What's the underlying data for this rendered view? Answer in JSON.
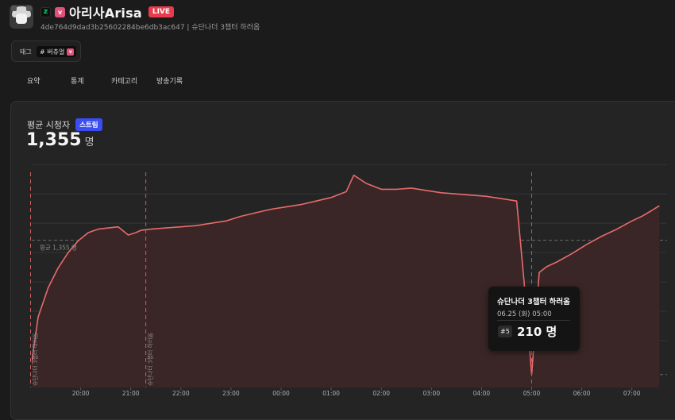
{
  "channel": {
    "name": "아리사Arisa",
    "live_badge": "LIVE",
    "platform_icon_label": "z",
    "vtuber_icon_label": "v",
    "subline": "4de764d9dad3b25602284be6db3ac647 | 슈단나더 3챕터 하러옴"
  },
  "tags": {
    "label": "태그",
    "items": [
      {
        "text": "# 버츄얼"
      }
    ]
  },
  "tabs": [
    "요약",
    "통계",
    "카테고리",
    "방송기록"
  ],
  "metric": {
    "label": "평균 시청자",
    "badge": "스트림",
    "value": "1,355",
    "unit": "명"
  },
  "chart_data": {
    "type": "area",
    "avg_label": "평균 1,355 명",
    "average": 1355,
    "ylim": [
      100,
      2050
    ],
    "x_ticks": [
      "20:00",
      "21:00",
      "22:00",
      "23:00",
      "00:00",
      "01:00",
      "02:00",
      "03:00",
      "04:00",
      "05:00",
      "06:00",
      "07:00"
    ],
    "x_tick_hours": [
      20,
      21,
      22,
      23,
      24,
      25,
      26,
      27,
      28,
      29,
      30,
      31
    ],
    "markers": [
      {
        "hour": 19.0,
        "label": "슈단나더 3챕터 하러옴"
      },
      {
        "hour": 21.3,
        "label": "슈단나더 3챕터 하러옴"
      },
      {
        "hour": 29.0,
        "label": ""
      }
    ],
    "series": [
      {
        "color": "#e86b6b",
        "x": [
          19.0,
          19.15,
          19.35,
          19.55,
          19.75,
          19.95,
          20.15,
          20.35,
          20.55,
          20.75,
          20.95,
          21.1,
          21.2,
          21.4,
          21.7,
          22.0,
          22.3,
          22.6,
          22.9,
          23.2,
          23.5,
          23.8,
          24.1,
          24.4,
          24.7,
          25.0,
          25.3,
          25.45,
          25.7,
          26.0,
          26.3,
          26.6,
          26.9,
          27.2,
          27.5,
          27.8,
          28.1,
          28.4,
          28.7,
          28.85,
          29.0,
          29.15,
          29.3,
          29.5,
          29.8,
          30.1,
          30.4,
          30.7,
          31.0,
          31.2,
          31.4,
          31.55
        ],
        "y": [
          250,
          700,
          950,
          1120,
          1250,
          1350,
          1420,
          1450,
          1460,
          1470,
          1400,
          1420,
          1440,
          1450,
          1460,
          1470,
          1480,
          1500,
          1520,
          1560,
          1590,
          1620,
          1640,
          1660,
          1690,
          1720,
          1770,
          1910,
          1840,
          1790,
          1790,
          1800,
          1780,
          1760,
          1750,
          1740,
          1730,
          1710,
          1690,
          1000,
          210,
          1080,
          1130,
          1170,
          1240,
          1320,
          1390,
          1450,
          1520,
          1560,
          1610,
          1650
        ]
      }
    ]
  },
  "tooltip": {
    "title": "슈단나더 3챕터 하러옴",
    "date": "06.25 (화) 05:00",
    "rank": "#5",
    "value": "210 명"
  }
}
